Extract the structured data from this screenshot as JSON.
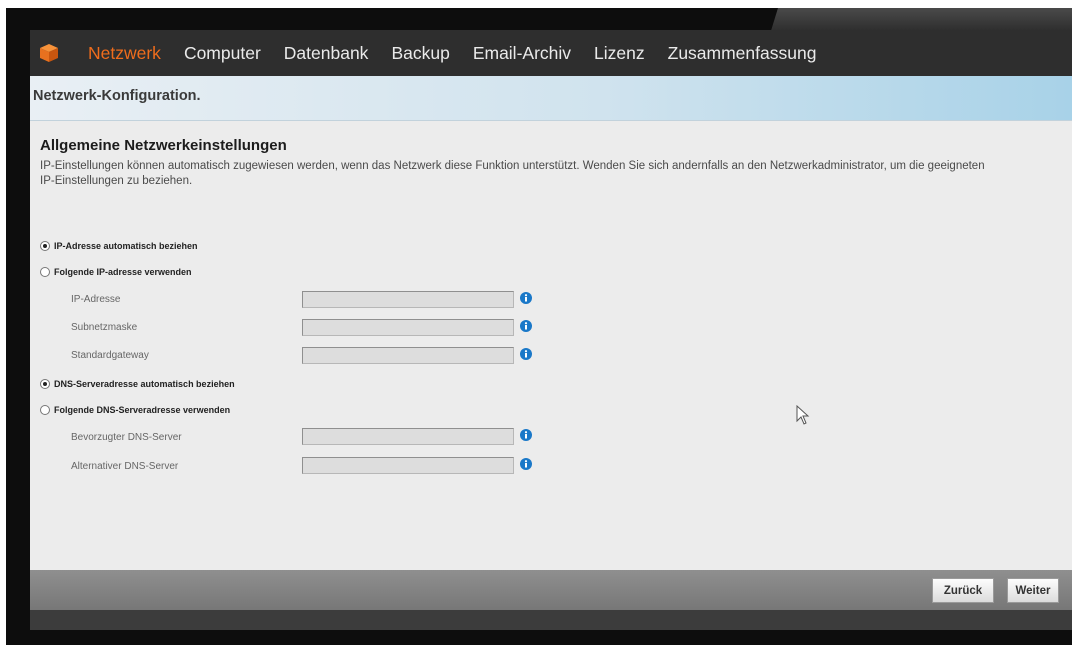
{
  "nav": {
    "logo_icon": "orange-cube-icon",
    "items": [
      "Netzwerk",
      "Computer",
      "Datenbank",
      "Backup",
      "Email-Archiv",
      "Lizenz",
      "Zusammenfassung"
    ],
    "active_index": 0,
    "active_color": "#ef6c1c"
  },
  "header": {
    "title": "Netzwerk-Konfiguration."
  },
  "section": {
    "title": "Allgemeine Netzwerkeinstellungen",
    "description": "IP-Einstellungen können automatisch zugewiesen werden, wenn das Netzwerk diese Funktion unterstützt. Wenden Sie sich andernfalls an den Netzwerkadministrator, um die geeigneten IP-Einstellungen zu beziehen."
  },
  "ip": {
    "auto_label": "IP-Adresse automatisch beziehen",
    "manual_label": "Folgende IP-adresse verwenden",
    "selected": "auto",
    "fields": [
      {
        "label": "IP-Adresse",
        "value": ""
      },
      {
        "label": "Subnetzmaske",
        "value": ""
      },
      {
        "label": "Standardgateway",
        "value": ""
      }
    ]
  },
  "dns": {
    "auto_label": "DNS-Serveradresse automatisch beziehen",
    "manual_label": "Folgende DNS-Serveradresse verwenden",
    "selected": "auto",
    "fields": [
      {
        "label": "Bevorzugter DNS-Server",
        "value": ""
      },
      {
        "label": "Alternativer DNS-Server",
        "value": ""
      }
    ]
  },
  "footer": {
    "back_label": "Zurück",
    "next_label": "Weiter"
  },
  "colors": {
    "info_icon": "#1a78c8",
    "header_gradient_end": "#a8d2e8"
  }
}
